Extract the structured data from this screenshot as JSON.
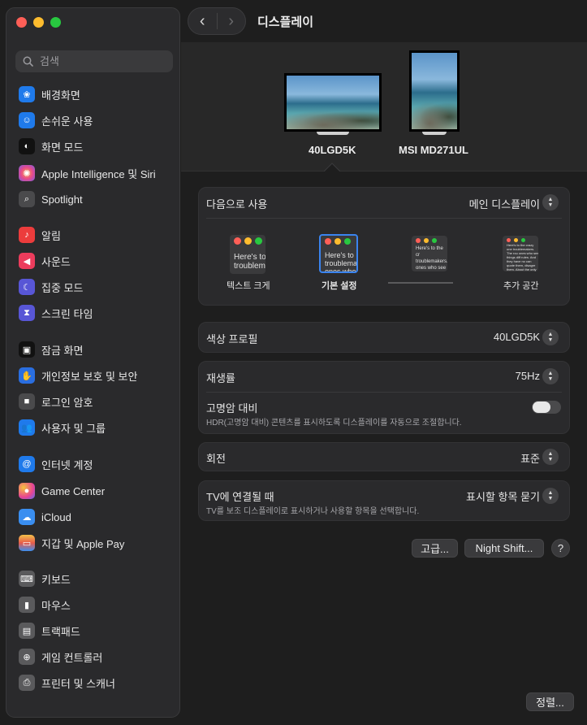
{
  "window": {
    "title": "디스플레이"
  },
  "search": {
    "placeholder": "검색"
  },
  "sidebar": {
    "items": [
      {
        "label": "배경화면",
        "icon": "wallpaper-icon",
        "color": "#1f7aeb"
      },
      {
        "label": "손쉬운 사용",
        "icon": "accessibility-icon",
        "color": "#1f7aeb"
      },
      {
        "label": "화면 모드",
        "icon": "appearance-icon",
        "color": "#111111"
      },
      {
        "label": "Apple Intelligence 및 Siri",
        "icon": "apple-intelligence-icon",
        "color": "#9c5be0"
      },
      {
        "label": "Spotlight",
        "icon": "spotlight-icon",
        "color": "#4a4a4c"
      },
      {
        "label": "알림",
        "icon": "notifications-icon",
        "color": "#ec3c3c"
      },
      {
        "label": "사운드",
        "icon": "sound-icon",
        "color": "#ec3c5c"
      },
      {
        "label": "집중 모드",
        "icon": "focus-icon",
        "color": "#5856d6"
      },
      {
        "label": "스크린 타임",
        "icon": "screen-time-icon",
        "color": "#5856d6"
      },
      {
        "label": "잠금 화면",
        "icon": "lock-screen-icon",
        "color": "#111111"
      },
      {
        "label": "개인정보 보호 및 보안",
        "icon": "privacy-hand-icon",
        "color": "#2a6ee0"
      },
      {
        "label": "로그인 암호",
        "icon": "login-password-icon",
        "color": "#4a4a4c"
      },
      {
        "label": "사용자 및 그룹",
        "icon": "users-groups-icon",
        "color": "#1f7aeb"
      },
      {
        "label": "인터넷 계정",
        "icon": "internet-accounts-icon",
        "color": "#1f7aeb"
      },
      {
        "label": "Game Center",
        "icon": "game-center-icon",
        "color": "#e84393"
      },
      {
        "label": "iCloud",
        "icon": "icloud-icon",
        "color": "#3a8ef0"
      },
      {
        "label": "지갑 및 Apple Pay",
        "icon": "wallet-icon",
        "color": "#2b2b2b"
      },
      {
        "label": "키보드",
        "icon": "keyboard-icon",
        "color": "#5a5a5c"
      },
      {
        "label": "마우스",
        "icon": "mouse-icon",
        "color": "#5a5a5c"
      },
      {
        "label": "트랙패드",
        "icon": "trackpad-icon",
        "color": "#5a5a5c"
      },
      {
        "label": "게임 컨트롤러",
        "icon": "game-controller-icon",
        "color": "#5a5a5c"
      },
      {
        "label": "프린터 및 스캐너",
        "icon": "printer-icon",
        "color": "#5a5a5c"
      }
    ]
  },
  "displays": [
    {
      "name": "40LGD5K"
    },
    {
      "name": "MSI MD271UL"
    }
  ],
  "use_as": {
    "label": "다음으로 사용",
    "value": "메인 디스플레이"
  },
  "resolution": {
    "options": [
      {
        "label": "텍스트 크게",
        "preview": "Here's to troublem"
      },
      {
        "label": "기본 설정",
        "preview": "Here's to troublema ones who"
      },
      {
        "label": "",
        "preview": "Here's to the cr troublemakers. ones who see t rules. And they"
      },
      {
        "label": "추가 공간",
        "preview": "Here's to the crazy one troublemakers. The rou ones who see things diff rules. And they have no can quote them, disagre them. About the only thi Because they change th"
      }
    ]
  },
  "color_profile": {
    "label": "색상 프로필",
    "value": "40LGD5K"
  },
  "refresh_rate": {
    "label": "재생률",
    "value": "75Hz"
  },
  "hdr": {
    "label": "고명암 대비",
    "description": "HDR(고명암 대비) 콘텐츠를 표시하도록 디스플레이를 자동으로 조절합니다.",
    "enabled": false
  },
  "rotation": {
    "label": "회전",
    "value": "표준"
  },
  "tv": {
    "label": "TV에 연결될 때",
    "value": "표시할 항목 묻기",
    "description": "TV를 보조 디스플레이로 표시하거나 사용할 항목을 선택합니다."
  },
  "buttons": {
    "advanced": "고급...",
    "night_shift": "Night Shift...",
    "help": "?",
    "arrange": "정렬..."
  }
}
